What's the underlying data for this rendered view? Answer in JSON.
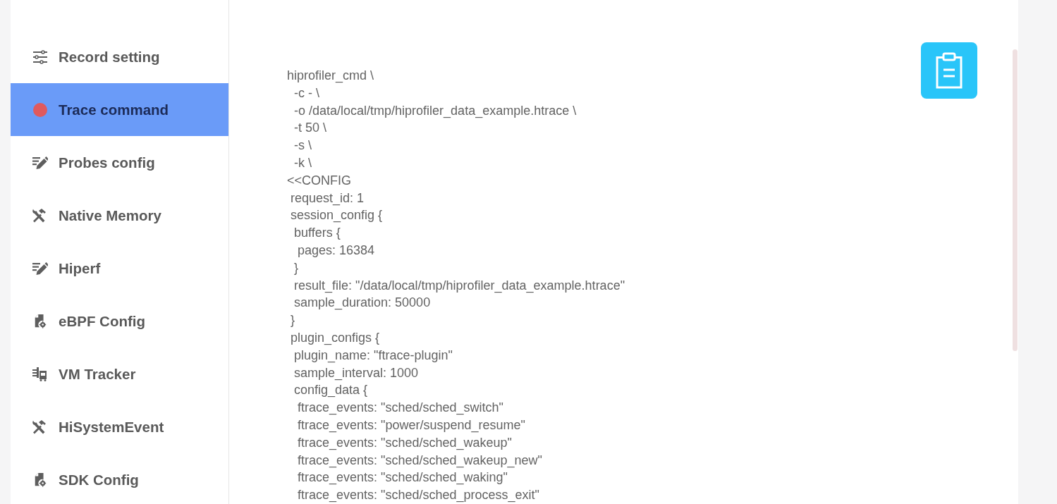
{
  "sidebar": {
    "items": [
      {
        "label": "Record setting",
        "selected": false
      },
      {
        "label": "Trace command",
        "selected": true
      },
      {
        "label": "Probes config",
        "selected": false
      },
      {
        "label": "Native Memory",
        "selected": false
      },
      {
        "label": "Hiperf",
        "selected": false
      },
      {
        "label": "eBPF Config",
        "selected": false
      },
      {
        "label": "VM Tracker",
        "selected": false
      },
      {
        "label": "HiSystemEvent",
        "selected": false
      },
      {
        "label": "SDK Config",
        "selected": false
      }
    ]
  },
  "command": {
    "lines": [
      "hiprofiler_cmd \\",
      "  -c - \\",
      "  -o /data/local/tmp/hiprofiler_data_example.htrace \\",
      "  -t 50 \\",
      "  -s \\",
      "  -k \\",
      "<<CONFIG",
      " request_id: 1",
      " session_config {",
      "  buffers {",
      "   pages: 16384",
      "  }",
      "  result_file: \"/data/local/tmp/hiprofiler_data_example.htrace\"",
      "  sample_duration: 50000",
      " }",
      " plugin_configs {",
      "  plugin_name: \"ftrace-plugin\"",
      "  sample_interval: 1000",
      "  config_data {",
      "   ftrace_events: \"sched/sched_switch\"",
      "   ftrace_events: \"power/suspend_resume\"",
      "   ftrace_events: \"sched/sched_wakeup\"",
      "   ftrace_events: \"sched/sched_wakeup_new\"",
      "   ftrace_events: \"sched/sched_waking\"",
      "   ftrace_events: \"sched/sched_process_exit\""
    ]
  }
}
